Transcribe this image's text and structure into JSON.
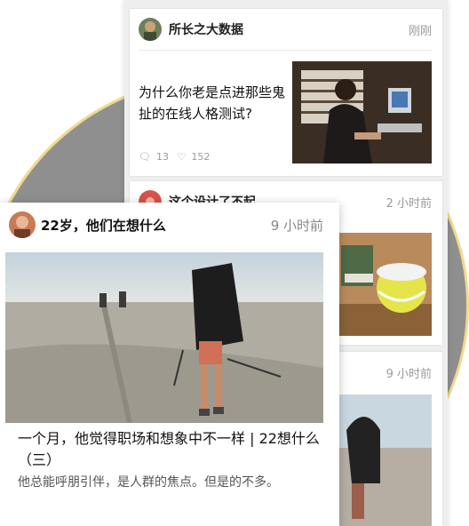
{
  "feed": {
    "card1": {
      "author": "所长之大数据",
      "time": "刚刚",
      "title": "为什么你老是点进那些鬼扯的在线人格测试?",
      "comments": "13",
      "likes": "152",
      "comment_icon": "comment-icon",
      "like_icon": "heart-icon"
    },
    "card2": {
      "author": "这个设计了不起",
      "time": "2 小时前"
    },
    "card3": {
      "time": "9 小时前"
    }
  },
  "magnified": {
    "author": "22岁，他们在想什么",
    "time": "9 小时前",
    "title": "一个月，他觉得职场和想象中不一样 | 22想什么（三）",
    "body": "他总能呼朋引伴，是人群的焦点。但是的不多。"
  },
  "colors": {
    "circle_border": "#f1d98b",
    "circle_fill": "#8f8f8f",
    "background": "#eeeeee"
  }
}
